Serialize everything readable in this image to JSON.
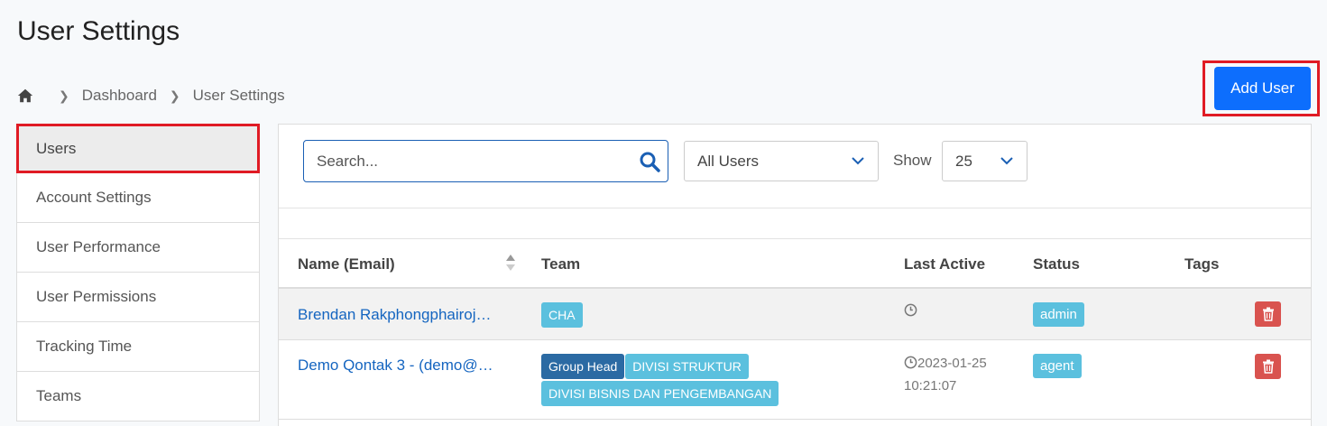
{
  "page": {
    "title": "User Settings"
  },
  "breadcrumb": {
    "items": [
      "Dashboard",
      "User Settings"
    ]
  },
  "header": {
    "add_user_label": "Add User"
  },
  "sidebar": {
    "items": [
      {
        "label": "Users",
        "active": true
      },
      {
        "label": "Account Settings"
      },
      {
        "label": "User Performance"
      },
      {
        "label": "User Permissions"
      },
      {
        "label": "Tracking Time"
      },
      {
        "label": "Teams"
      }
    ]
  },
  "filters": {
    "search_placeholder": "Search...",
    "user_filter_value": "All Users",
    "show_label": "Show",
    "page_size_value": "25"
  },
  "table": {
    "columns": [
      "Name (Email)",
      "Team",
      "Last Active",
      "Status",
      "Tags"
    ],
    "rows": [
      {
        "name": "Brendan Rakphongphairoj…",
        "teams": [
          {
            "label": "CHA",
            "style": "info"
          }
        ],
        "last_active": "",
        "status": "admin"
      },
      {
        "name": "Demo Qontak 3 - (demo@…",
        "teams": [
          {
            "label": "Group Head",
            "style": "primary"
          },
          {
            "label": "DIVISI STRUKTUR",
            "style": "info"
          },
          {
            "label": "DIVISI BISNIS DAN PENGEMBANGAN",
            "style": "info"
          }
        ],
        "last_active_date": "2023-01-25",
        "last_active_time": "10:21:07",
        "status": "agent"
      }
    ]
  },
  "colors": {
    "primary": "#0d6efd",
    "info": "#5bc0de",
    "danger": "#d9534f",
    "link": "#1565c0",
    "highlight": "#e01b24"
  }
}
